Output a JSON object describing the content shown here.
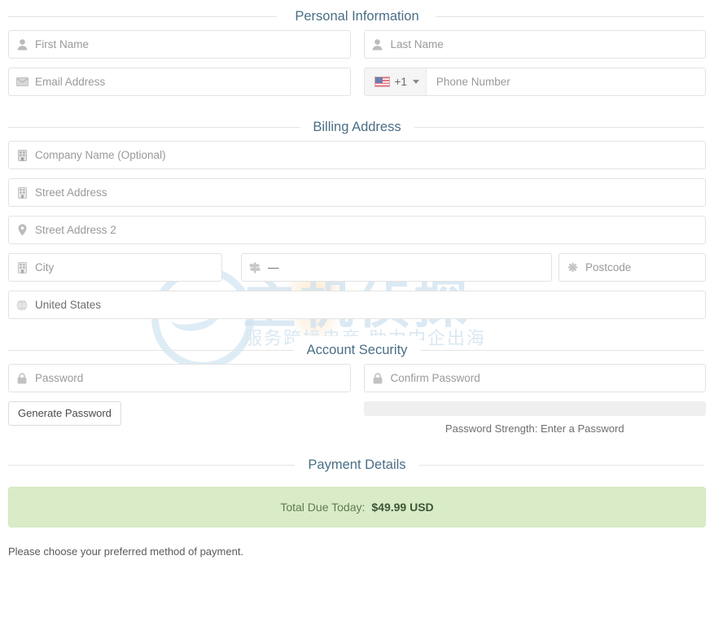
{
  "watermark": {
    "main_text": "主机侦探",
    "sub_text": "服务跨境电商 助力中企出海"
  },
  "sections": {
    "personal": {
      "title": "Personal Information"
    },
    "billing": {
      "title": "Billing Address"
    },
    "security": {
      "title": "Account Security"
    },
    "payment": {
      "title": "Payment Details"
    }
  },
  "personal": {
    "first_name": {
      "placeholder": "First Name",
      "icon": "user-icon"
    },
    "last_name": {
      "placeholder": "Last Name",
      "icon": "user-icon"
    },
    "email": {
      "placeholder": "Email Address",
      "icon": "envelope-icon"
    },
    "phone": {
      "country_code": "+1",
      "country_flag": "us-flag-icon",
      "placeholder": "Phone Number"
    }
  },
  "billing": {
    "company": {
      "placeholder": "Company Name (Optional)",
      "icon": "building-icon"
    },
    "street1": {
      "placeholder": "Street Address",
      "icon": "building-icon"
    },
    "street2": {
      "placeholder": "Street Address 2",
      "icon": "map-marker-icon"
    },
    "city": {
      "placeholder": "City",
      "icon": "building-icon"
    },
    "state": {
      "value": "—",
      "icon": "map-signs-icon"
    },
    "postcode": {
      "placeholder": "Postcode",
      "icon": "asterisk-icon"
    },
    "country": {
      "value": "United States",
      "icon": "globe-icon"
    }
  },
  "security": {
    "password": {
      "placeholder": "Password",
      "icon": "lock-icon"
    },
    "confirm_password": {
      "placeholder": "Confirm Password",
      "icon": "lock-icon"
    },
    "generate_button": "Generate Password",
    "strength_label": "Password Strength: Enter a Password",
    "strength_percent": 0
  },
  "payment": {
    "total_label": "Total Due Today:",
    "total_amount": "$49.99 USD",
    "note": "Please choose your preferred method of payment."
  },
  "colors": {
    "section_title": "#4a6e85",
    "total_box_bg": "#d9ecc7",
    "total_amount": "#3d5636",
    "placeholder": "#9a9a9a"
  }
}
